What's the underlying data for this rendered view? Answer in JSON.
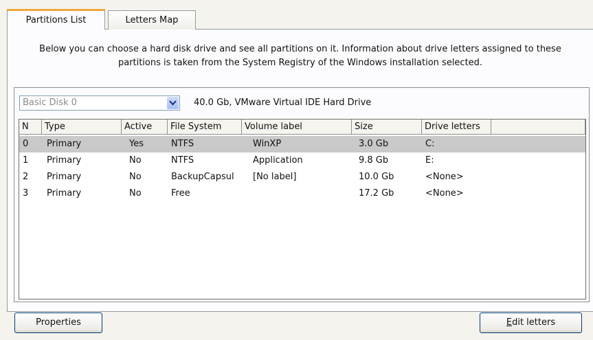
{
  "tabs": [
    {
      "label": "Partitions List",
      "active": true
    },
    {
      "label": "Letters Map",
      "active": false
    }
  ],
  "description": "Below you can choose a hard disk drive and see all partitions on it. Information about drive letters assigned to these partitions is taken from the System Registry of the Windows installation selected.",
  "disk_select": {
    "value": "Basic Disk 0"
  },
  "disk_info": "40.0 Gb, VMware Virtual IDE Hard Drive",
  "table": {
    "columns": [
      "N",
      "Type",
      "Active",
      "File System",
      "Volume label",
      "Size",
      "Drive letters"
    ],
    "rows": [
      [
        "0",
        "Primary",
        "Yes",
        "NTFS",
        "WinXP",
        "3.0 Gb",
        "C:"
      ],
      [
        "1",
        "Primary",
        "No",
        "NTFS",
        "Application",
        "9.8 Gb",
        "E:"
      ],
      [
        "2",
        "Primary",
        "No",
        "BackupCapsul",
        "[No label]",
        "10.0 Gb",
        "<None>"
      ],
      [
        "3",
        "Primary",
        "No",
        "Free",
        "",
        "17.2 Gb",
        "<None>"
      ]
    ],
    "selected_row": 0
  },
  "buttons": {
    "properties": "Properties",
    "edit_letters_mnemonic": "E",
    "edit_letters_rest": "dit letters"
  },
  "icons": {
    "combo_arrow": "chevron-down-icon"
  },
  "colors": {
    "selected_row": "#c9c9c9",
    "active_tab_accent": "#f2a63a"
  }
}
